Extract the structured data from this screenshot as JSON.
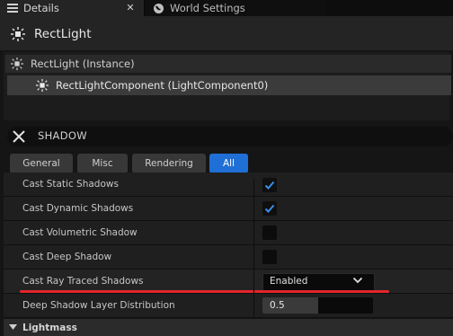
{
  "tabs": [
    {
      "label": "Details",
      "active": true
    },
    {
      "label": "World Settings",
      "active": false
    }
  ],
  "close_glyph": "✕",
  "header": {
    "title": "RectLight"
  },
  "components": {
    "root": "RectLight (Instance)",
    "child": "RectLightComponent (LightComponent0)"
  },
  "search": {
    "value": "SHADOW"
  },
  "filter_tabs": [
    "General",
    "Misc",
    "Rendering",
    "All"
  ],
  "properties": [
    {
      "label": "Cast Static Shadows",
      "type": "checkbox",
      "checked": true
    },
    {
      "label": "Cast Dynamic Shadows",
      "type": "checkbox",
      "checked": true
    },
    {
      "label": "Cast Volumetric Shadow",
      "type": "checkbox",
      "checked": false
    },
    {
      "label": "Cast Deep Shadow",
      "type": "checkbox",
      "checked": false
    },
    {
      "label": "Cast Ray Traced Shadows",
      "type": "dropdown",
      "value": "Enabled"
    },
    {
      "label": "Deep Shadow Layer Distribution",
      "type": "number",
      "value": "0.5",
      "fill_fraction": 0.5
    }
  ],
  "section": {
    "label": "Lightmass"
  },
  "colors": {
    "accent": "#1f6fd6",
    "annotation": "#e2262b",
    "check": "#3a8ee6"
  },
  "icons": [
    "details-icon",
    "globe-icon",
    "light-bulb-icon",
    "close-icon",
    "checkmark-icon",
    "chevron-down-icon",
    "collapse-arrow-icon"
  ]
}
